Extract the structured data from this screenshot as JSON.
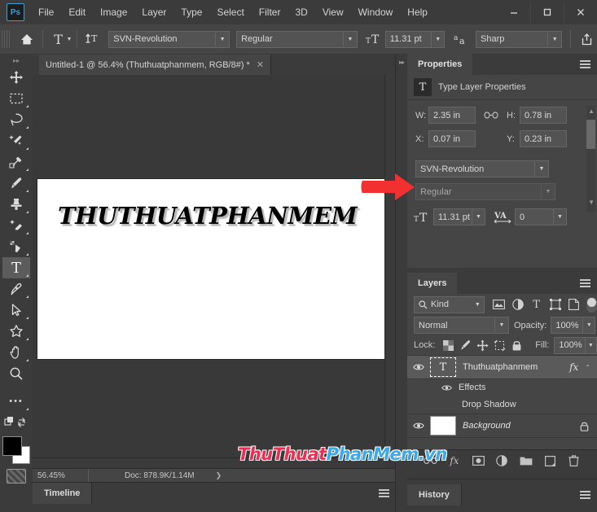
{
  "app": {
    "name": "Ps",
    "logo_color": "#3aa0d8"
  },
  "menubar": {
    "items": [
      "File",
      "Edit",
      "Image",
      "Layer",
      "Type",
      "Select",
      "Filter",
      "3D",
      "View",
      "Window",
      "Help"
    ],
    "window_controls": {
      "minimize": "—",
      "maximize": "▢",
      "close": "✕"
    }
  },
  "options_bar": {
    "home_icon": "home-icon",
    "tool_icon": "type-tool-icon",
    "orientation_icon": "text-orientation-icon",
    "font_family": "SVN-Revolution",
    "font_style": "Regular",
    "size_icon": "font-size-icon",
    "font_size": "11.31 pt",
    "antialias_icon": "anti-alias-icon",
    "antialias": "Sharp",
    "share_icon": "share-icon"
  },
  "toolbar": {
    "tools": [
      {
        "name": "move-tool",
        "glyph": "✥",
        "selected": false,
        "corner": false
      },
      {
        "name": "rectangular-marquee-tool",
        "glyph": "▢",
        "selected": false,
        "corner": true
      },
      {
        "name": "lasso-tool",
        "glyph": "◯",
        "selected": false,
        "corner": true
      },
      {
        "name": "quick-selection-tool",
        "glyph": "✨",
        "selected": false,
        "corner": true
      },
      {
        "name": "eyedropper-tool",
        "glyph": "✒",
        "selected": false,
        "corner": true
      },
      {
        "name": "brush-tool",
        "glyph": "🖌",
        "selected": false,
        "corner": true
      },
      {
        "name": "clone-stamp-tool",
        "glyph": "▲",
        "selected": false,
        "corner": true
      },
      {
        "name": "eraser-tool",
        "glyph": "◧",
        "selected": false,
        "corner": true
      },
      {
        "name": "gradient-tool",
        "glyph": "◨",
        "selected": false,
        "corner": true
      },
      {
        "name": "horizontal-type-tool",
        "glyph": "T",
        "selected": true,
        "corner": true
      },
      {
        "name": "pen-tool",
        "glyph": "✎",
        "selected": false,
        "corner": true
      },
      {
        "name": "path-selection-tool",
        "glyph": "➤",
        "selected": false,
        "corner": true
      },
      {
        "name": "custom-shape-tool",
        "glyph": "★",
        "selected": false,
        "corner": true
      },
      {
        "name": "hand-tool",
        "glyph": "✋",
        "selected": false,
        "corner": true
      },
      {
        "name": "zoom-tool",
        "glyph": "🔍",
        "selected": false,
        "corner": false
      },
      {
        "name": "more-tools",
        "glyph": "•••",
        "selected": false,
        "corner": true
      },
      {
        "name": "edit-toolbar",
        "glyph": "◪",
        "selected": false,
        "corner": false
      }
    ],
    "foreground_color": "#000000",
    "background_color": "#ffffff",
    "quick_mask": "quick-mask-icon"
  },
  "document": {
    "tab_title": "Untitled-1 @ 56.4% (Thuthuatphanmem, RGB/8#) *",
    "close_glyph": "✕",
    "canvas_text": "THUTHUATPHANMEM",
    "canvas_bg": "#ffffff"
  },
  "status_bar": {
    "zoom": "56.45%",
    "doc": "Doc: 878.9K/1.14M",
    "expand_glyph": "❯"
  },
  "timeline_panel": {
    "tab": "Timeline",
    "menu_icon": "panel-menu-icon"
  },
  "history_panel": {
    "tab": "History",
    "menu_icon": "panel-menu-icon"
  },
  "properties_panel": {
    "tab": "Properties",
    "menu_icon": "panel-menu-icon",
    "header_icon": "T",
    "header_label": "Type Layer Properties",
    "w_label": "W:",
    "w_value": "2.35 in",
    "link_icon": "link-icon",
    "h_label": "H:",
    "h_value": "0.78 in",
    "x_label": "X:",
    "x_value": "0.07 in",
    "y_label": "Y:",
    "y_value": "0.23 in",
    "font_family": "SVN-Revolution",
    "font_style": "Regular",
    "size_icon": "font-size-icon",
    "font_size": "11.31 pt",
    "tracking_icon": "tracking-icon",
    "tracking": "0"
  },
  "layers_panel": {
    "tab": "Layers",
    "menu_icon": "panel-menu-icon",
    "filter_placeholder": "Kind",
    "search_icon": "search-icon",
    "filter_icons": [
      "pixel-filter-icon",
      "adjustment-filter-icon",
      "type-filter-icon",
      "shape-filter-icon",
      "smart-object-filter-icon"
    ],
    "filter_toggle": "filter-toggle",
    "blend_mode": "Normal",
    "opacity_label": "Opacity:",
    "opacity_value": "100%",
    "lock_label": "Lock:",
    "lock_icons": [
      "lock-transparent-pixels-icon",
      "lock-image-pixels-icon",
      "lock-position-icon",
      "lock-artboard-icon",
      "lock-all-icon"
    ],
    "fill_label": "Fill:",
    "fill_value": "100%",
    "layers": [
      {
        "name": "Thuthuatphanmem",
        "type": "text",
        "visible": true,
        "active": true,
        "fx_badge": "fx",
        "collapse_glyph": "⌃",
        "italic": false,
        "locked": false
      },
      {
        "name": "Effects",
        "type": "effects-group",
        "visible": true,
        "active": false,
        "italic": false
      },
      {
        "name": "Drop Shadow",
        "type": "effect",
        "visible": false,
        "active": false,
        "italic": false
      },
      {
        "name": "Background",
        "type": "raster",
        "visible": true,
        "active": false,
        "italic": true,
        "locked": true,
        "lock_glyph": "🔒"
      }
    ],
    "footer_icons": [
      "link-layers-icon",
      "layer-style-icon",
      "layer-mask-icon",
      "adjustment-layer-icon",
      "new-group-icon",
      "new-layer-icon",
      "delete-layer-icon"
    ]
  },
  "watermark": {
    "part1": "ThuThuat",
    "part2": "PhanMem.vn",
    "color1": "#ef2d52",
    "color2": "#3ba9e8"
  },
  "annotation": {
    "arrow": "red-arrow-pointing-right",
    "color": "#f2302f"
  }
}
